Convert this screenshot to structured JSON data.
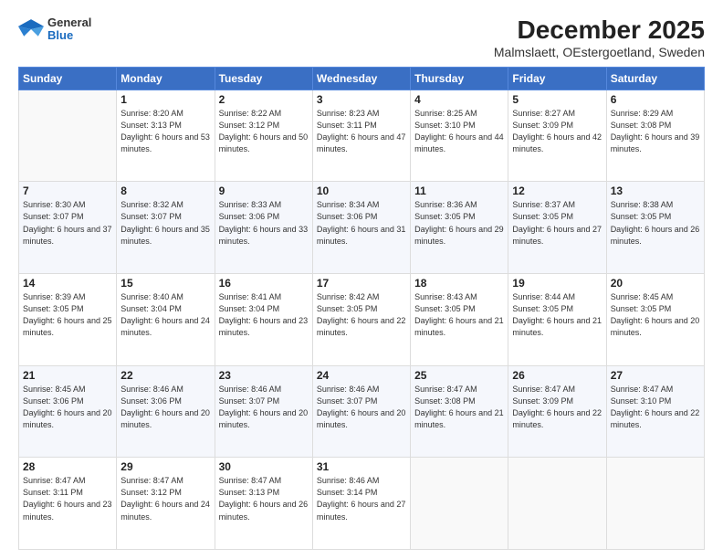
{
  "header": {
    "logo_general": "General",
    "logo_blue": "Blue",
    "title": "December 2025",
    "subtitle": "Malmslaett, OEstergoetland, Sweden"
  },
  "days_of_week": [
    "Sunday",
    "Monday",
    "Tuesday",
    "Wednesday",
    "Thursday",
    "Friday",
    "Saturday"
  ],
  "weeks": [
    [
      {
        "day": "",
        "empty": true
      },
      {
        "day": "1",
        "sunrise": "8:20 AM",
        "sunset": "3:13 PM",
        "daylight": "6 hours and 53 minutes."
      },
      {
        "day": "2",
        "sunrise": "8:22 AM",
        "sunset": "3:12 PM",
        "daylight": "6 hours and 50 minutes."
      },
      {
        "day": "3",
        "sunrise": "8:23 AM",
        "sunset": "3:11 PM",
        "daylight": "6 hours and 47 minutes."
      },
      {
        "day": "4",
        "sunrise": "8:25 AM",
        "sunset": "3:10 PM",
        "daylight": "6 hours and 44 minutes."
      },
      {
        "day": "5",
        "sunrise": "8:27 AM",
        "sunset": "3:09 PM",
        "daylight": "6 hours and 42 minutes."
      },
      {
        "day": "6",
        "sunrise": "8:29 AM",
        "sunset": "3:08 PM",
        "daylight": "6 hours and 39 minutes."
      }
    ],
    [
      {
        "day": "7",
        "sunrise": "8:30 AM",
        "sunset": "3:07 PM",
        "daylight": "6 hours and 37 minutes."
      },
      {
        "day": "8",
        "sunrise": "8:32 AM",
        "sunset": "3:07 PM",
        "daylight": "6 hours and 35 minutes."
      },
      {
        "day": "9",
        "sunrise": "8:33 AM",
        "sunset": "3:06 PM",
        "daylight": "6 hours and 33 minutes."
      },
      {
        "day": "10",
        "sunrise": "8:34 AM",
        "sunset": "3:06 PM",
        "daylight": "6 hours and 31 minutes."
      },
      {
        "day": "11",
        "sunrise": "8:36 AM",
        "sunset": "3:05 PM",
        "daylight": "6 hours and 29 minutes."
      },
      {
        "day": "12",
        "sunrise": "8:37 AM",
        "sunset": "3:05 PM",
        "daylight": "6 hours and 27 minutes."
      },
      {
        "day": "13",
        "sunrise": "8:38 AM",
        "sunset": "3:05 PM",
        "daylight": "6 hours and 26 minutes."
      }
    ],
    [
      {
        "day": "14",
        "sunrise": "8:39 AM",
        "sunset": "3:05 PM",
        "daylight": "6 hours and 25 minutes."
      },
      {
        "day": "15",
        "sunrise": "8:40 AM",
        "sunset": "3:04 PM",
        "daylight": "6 hours and 24 minutes."
      },
      {
        "day": "16",
        "sunrise": "8:41 AM",
        "sunset": "3:04 PM",
        "daylight": "6 hours and 23 minutes."
      },
      {
        "day": "17",
        "sunrise": "8:42 AM",
        "sunset": "3:05 PM",
        "daylight": "6 hours and 22 minutes."
      },
      {
        "day": "18",
        "sunrise": "8:43 AM",
        "sunset": "3:05 PM",
        "daylight": "6 hours and 21 minutes."
      },
      {
        "day": "19",
        "sunrise": "8:44 AM",
        "sunset": "3:05 PM",
        "daylight": "6 hours and 21 minutes."
      },
      {
        "day": "20",
        "sunrise": "8:45 AM",
        "sunset": "3:05 PM",
        "daylight": "6 hours and 20 minutes."
      }
    ],
    [
      {
        "day": "21",
        "sunrise": "8:45 AM",
        "sunset": "3:06 PM",
        "daylight": "6 hours and 20 minutes."
      },
      {
        "day": "22",
        "sunrise": "8:46 AM",
        "sunset": "3:06 PM",
        "daylight": "6 hours and 20 minutes."
      },
      {
        "day": "23",
        "sunrise": "8:46 AM",
        "sunset": "3:07 PM",
        "daylight": "6 hours and 20 minutes."
      },
      {
        "day": "24",
        "sunrise": "8:46 AM",
        "sunset": "3:07 PM",
        "daylight": "6 hours and 20 minutes."
      },
      {
        "day": "25",
        "sunrise": "8:47 AM",
        "sunset": "3:08 PM",
        "daylight": "6 hours and 21 minutes."
      },
      {
        "day": "26",
        "sunrise": "8:47 AM",
        "sunset": "3:09 PM",
        "daylight": "6 hours and 22 minutes."
      },
      {
        "day": "27",
        "sunrise": "8:47 AM",
        "sunset": "3:10 PM",
        "daylight": "6 hours and 22 minutes."
      }
    ],
    [
      {
        "day": "28",
        "sunrise": "8:47 AM",
        "sunset": "3:11 PM",
        "daylight": "6 hours and 23 minutes."
      },
      {
        "day": "29",
        "sunrise": "8:47 AM",
        "sunset": "3:12 PM",
        "daylight": "6 hours and 24 minutes."
      },
      {
        "day": "30",
        "sunrise": "8:47 AM",
        "sunset": "3:13 PM",
        "daylight": "6 hours and 26 minutes."
      },
      {
        "day": "31",
        "sunrise": "8:46 AM",
        "sunset": "3:14 PM",
        "daylight": "6 hours and 27 minutes."
      },
      {
        "day": "",
        "empty": true
      },
      {
        "day": "",
        "empty": true
      },
      {
        "day": "",
        "empty": true
      }
    ]
  ]
}
